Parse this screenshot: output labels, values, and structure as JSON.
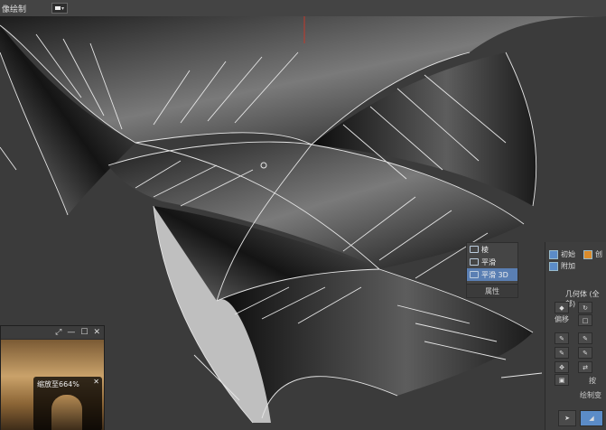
{
  "window": {
    "title_fragment": "像绘制"
  },
  "toolbar": {
    "swatch_color": "#eeeeee"
  },
  "viewport": {
    "background": "#3b3b3b",
    "wire_color": "#e6e6e6"
  },
  "context_menu": {
    "items": [
      {
        "label": "棱",
        "icon": "box-icon",
        "selected": false
      },
      {
        "label": "平滑",
        "icon": "box-icon",
        "selected": false
      },
      {
        "label": "平滑 3D",
        "icon": "box-icon",
        "selected": true
      }
    ],
    "footer": "属性"
  },
  "command_panel": {
    "row1_label": "初始",
    "row1_extra": "创",
    "row2_label": "附加",
    "group_title": "几何体 (全部)",
    "tool_label": "偏移",
    "subtitle1": "按",
    "subtitle2": "绘制变",
    "accent": "#5b8cc8"
  },
  "preview_window": {
    "zoom_label": "缩放至664%"
  }
}
